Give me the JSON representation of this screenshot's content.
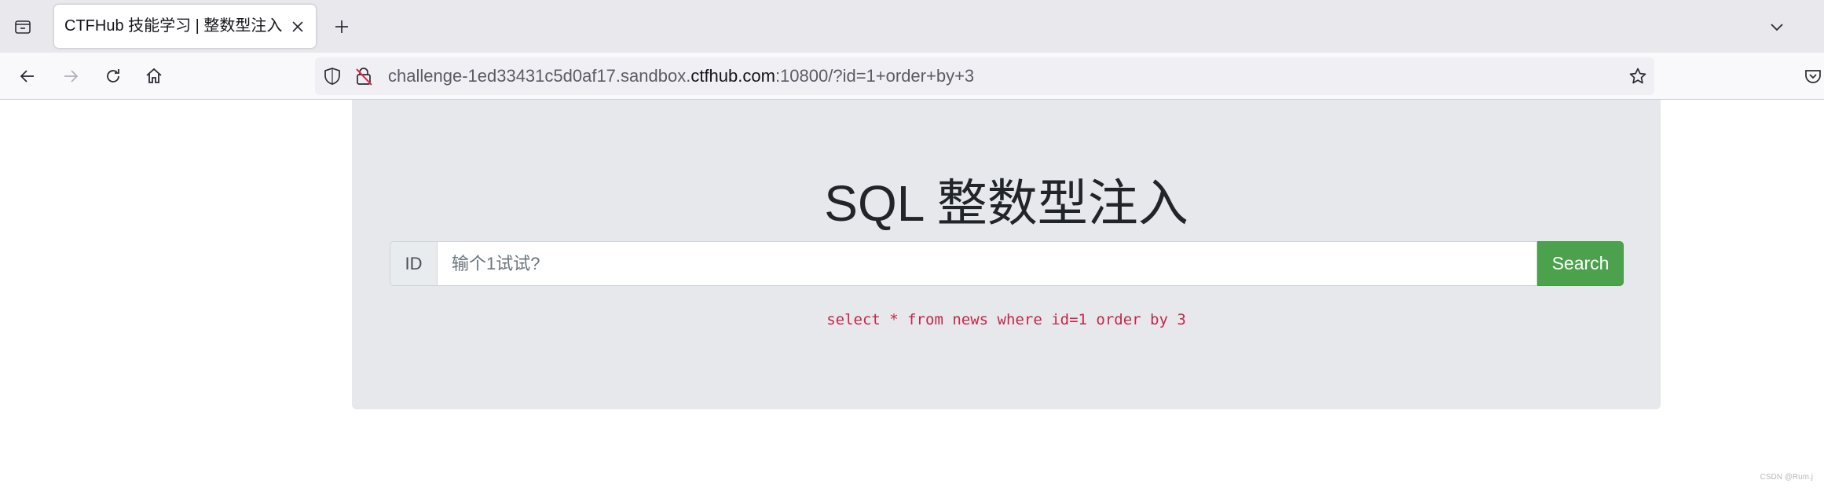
{
  "browser": {
    "tab": {
      "title": "CTFHub 技能学习 | 整数型注入"
    },
    "address": {
      "prefix": "challenge-1ed33431c5d0af17.sandbox.",
      "domain": "ctfhub.com",
      "suffix": ":10800/?id=1+order+by+3"
    },
    "icons": {
      "tab_list": "folder-tab-icon",
      "close_tab": "close-icon",
      "new_tab": "plus-icon",
      "tab_overflow": "chevron-down-icon",
      "back": "back-arrow-icon",
      "forward": "forward-arrow-icon",
      "reload": "reload-icon",
      "home": "home-icon",
      "tracking_protection": "shield-icon",
      "insecure": "lock-strikethrough-icon",
      "bookmark": "star-icon",
      "pocket": "pocket-icon"
    }
  },
  "page": {
    "heading": "SQL 整数型注入",
    "form": {
      "addon_label": "ID",
      "input_placeholder": "输个1试试?",
      "input_value": "",
      "submit_label": "Search"
    },
    "query": "select * from news where id=1 order by 3"
  },
  "watermark": "CSDN @Rum.j",
  "colors": {
    "search_button": "#4ca24c",
    "query_text": "#c7254e",
    "jumbotron_bg": "#e6e8eb"
  }
}
